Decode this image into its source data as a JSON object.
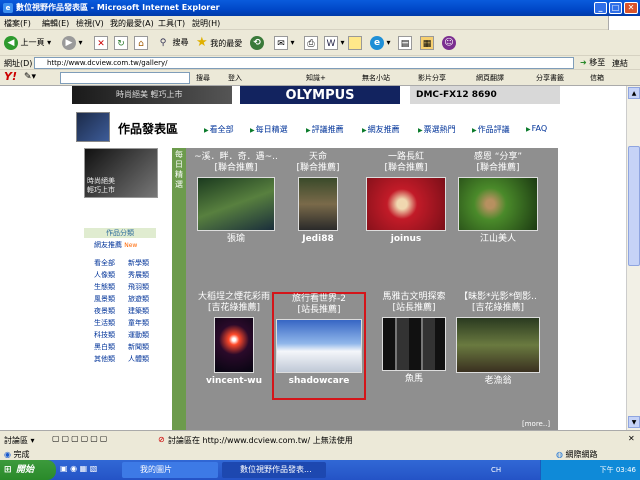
{
  "window": {
    "title": "數位視野作品發表區 - Microsoft Internet Explorer"
  },
  "menu": [
    "檔案(F)",
    "編輯(E)",
    "檢視(V)",
    "我的最愛(A)",
    "工具(T)",
    "說明(H)"
  ],
  "toolbar": {
    "back": "上一頁",
    "search": "搜尋",
    "favorites": "我的最愛"
  },
  "address": {
    "label": "網址(D)",
    "url": "http://www.dcview.com.tw/gallery/",
    "go": "移至",
    "links": "連結"
  },
  "yahoo": {
    "search_btn": "搜尋",
    "signin": "登入",
    "items": [
      "知識+",
      "無名小站",
      "影片分享",
      "網頁翻譯",
      "分享書籤",
      "信箱"
    ]
  },
  "banners": {
    "olympus": "OLYMPUS",
    "panasonic": "DMC-FX12 8690",
    "nikon_text": "時尚絕美  輕巧上市"
  },
  "nav": {
    "title": "作品發表區",
    "items": [
      "看全部",
      "每日精選",
      "評議推薦",
      "網友推薦",
      "票選熱門",
      "作品評議",
      "FAQ"
    ]
  },
  "left": {
    "nikon_caption": "時尚絕美 輕巧上市",
    "category_title": "作品分類",
    "recommend": "網友推薦",
    "new_badge": "New",
    "categories": [
      "看全部",
      "新學類",
      "人像類",
      "秀展類",
      "生態類",
      "飛羽類",
      "風景類",
      "旅遊類",
      "夜景類",
      "建築類",
      "生活類",
      "童年類",
      "科技類",
      "運動類",
      "黑白類",
      "新聞類",
      "其他類",
      "人體類"
    ]
  },
  "gallery": {
    "side_label": "每日精選",
    "more": "[more..]",
    "cells": [
      {
        "title": "~溪．畔．奇．遇~..",
        "tag": "[聯合推薦]",
        "user": "張瑜"
      },
      {
        "title": "天命",
        "tag": "[聯合推薦]",
        "user": "Jedi88"
      },
      {
        "title": "一路長紅",
        "tag": "[聯合推薦]",
        "user": "joinus"
      },
      {
        "title": "感恩 “分享”",
        "tag": "[聯合推薦]",
        "user": "江山美人"
      },
      {
        "title": "大稻埕之煙花彩雨",
        "tag": "[吉花綠推薦]",
        "user": "vincent-wu"
      },
      {
        "title": "旅行看世界-2",
        "tag": "[站長推薦]",
        "user": "shadowcare"
      },
      {
        "title": "馬雅古文明探索",
        "tag": "[站長推薦]",
        "user": "魚馬"
      },
      {
        "title": "【昧影*光影*倒影..",
        "tag": "[吉花綠推薦]",
        "user": "老漁翁"
      }
    ]
  },
  "statusbar": {
    "discuss": "討論區",
    "notice": "討論區在 http://www.dcview.com.tw/ 上無法使用",
    "status": "完成",
    "zone": "網際網路"
  },
  "taskbar": {
    "start": "開始",
    "tasks": [
      "我的圖片",
      "數位視野作品發表..."
    ],
    "lang": "CH",
    "clock": "下午 03:46"
  }
}
